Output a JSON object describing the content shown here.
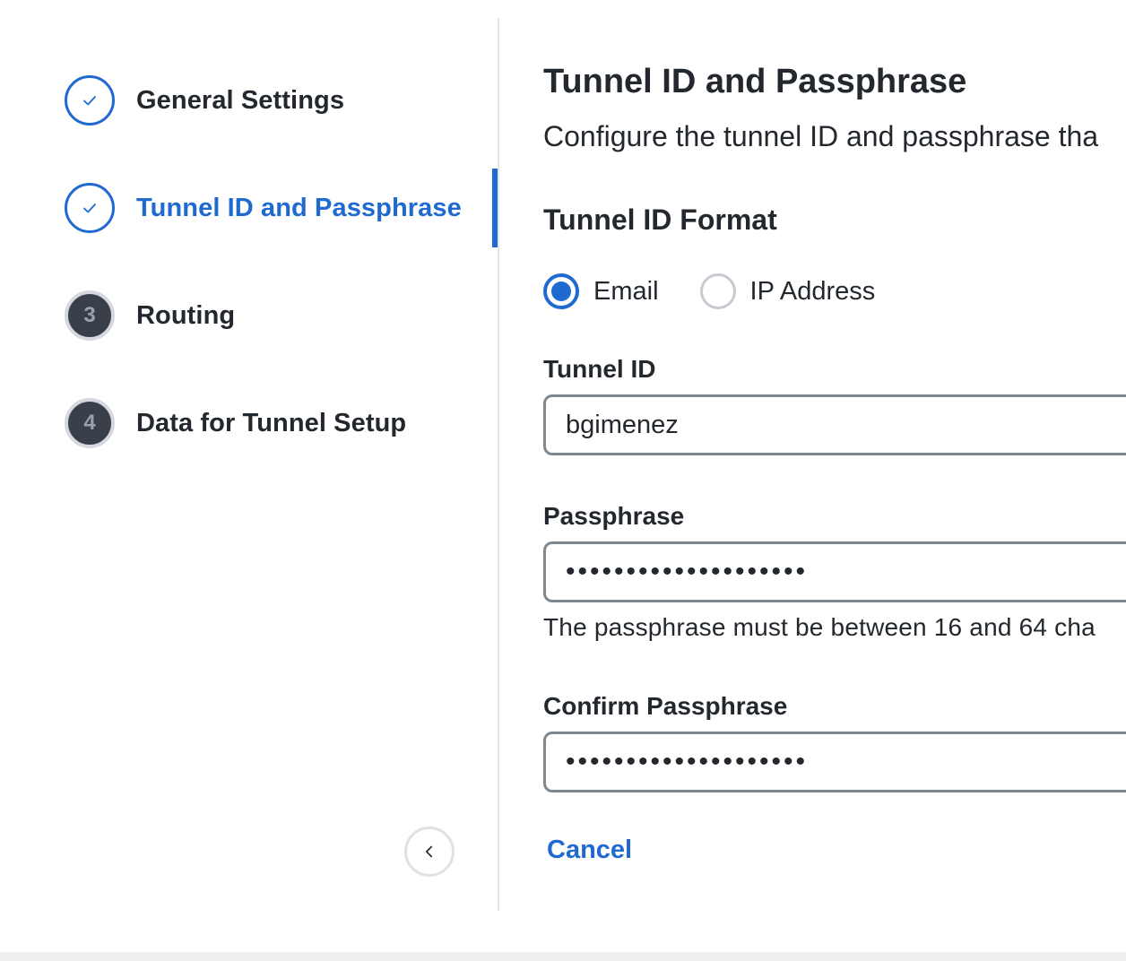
{
  "stepper": {
    "steps": [
      {
        "label": "General Settings",
        "state": "completed"
      },
      {
        "label": "Tunnel ID and Passphrase",
        "state": "active"
      },
      {
        "number": "3",
        "label": "Routing",
        "state": "pending"
      },
      {
        "number": "4",
        "label": "Data for Tunnel Setup",
        "state": "pending"
      }
    ],
    "collapse_icon": "chevron-left-icon"
  },
  "form": {
    "title": "Tunnel ID and Passphrase",
    "subtitle": "Configure the tunnel ID and passphrase tha",
    "tunnel_id_format": {
      "label": "Tunnel ID Format",
      "options": [
        {
          "label": "Email",
          "checked": true
        },
        {
          "label": "IP Address",
          "checked": false
        }
      ]
    },
    "tunnel_id": {
      "label": "Tunnel ID",
      "value": "bgimenez"
    },
    "passphrase": {
      "label": "Passphrase",
      "value": "••••••••••••••••••••",
      "hint": "The passphrase must be between 16 and 64 cha"
    },
    "confirm_passphrase": {
      "label": "Confirm Passphrase",
      "value": "••••••••••••••••••••"
    },
    "cancel_label": "Cancel"
  },
  "colors": {
    "accent": "#1f6ad1",
    "text": "#23282e",
    "pending_step": "#3a4049"
  }
}
